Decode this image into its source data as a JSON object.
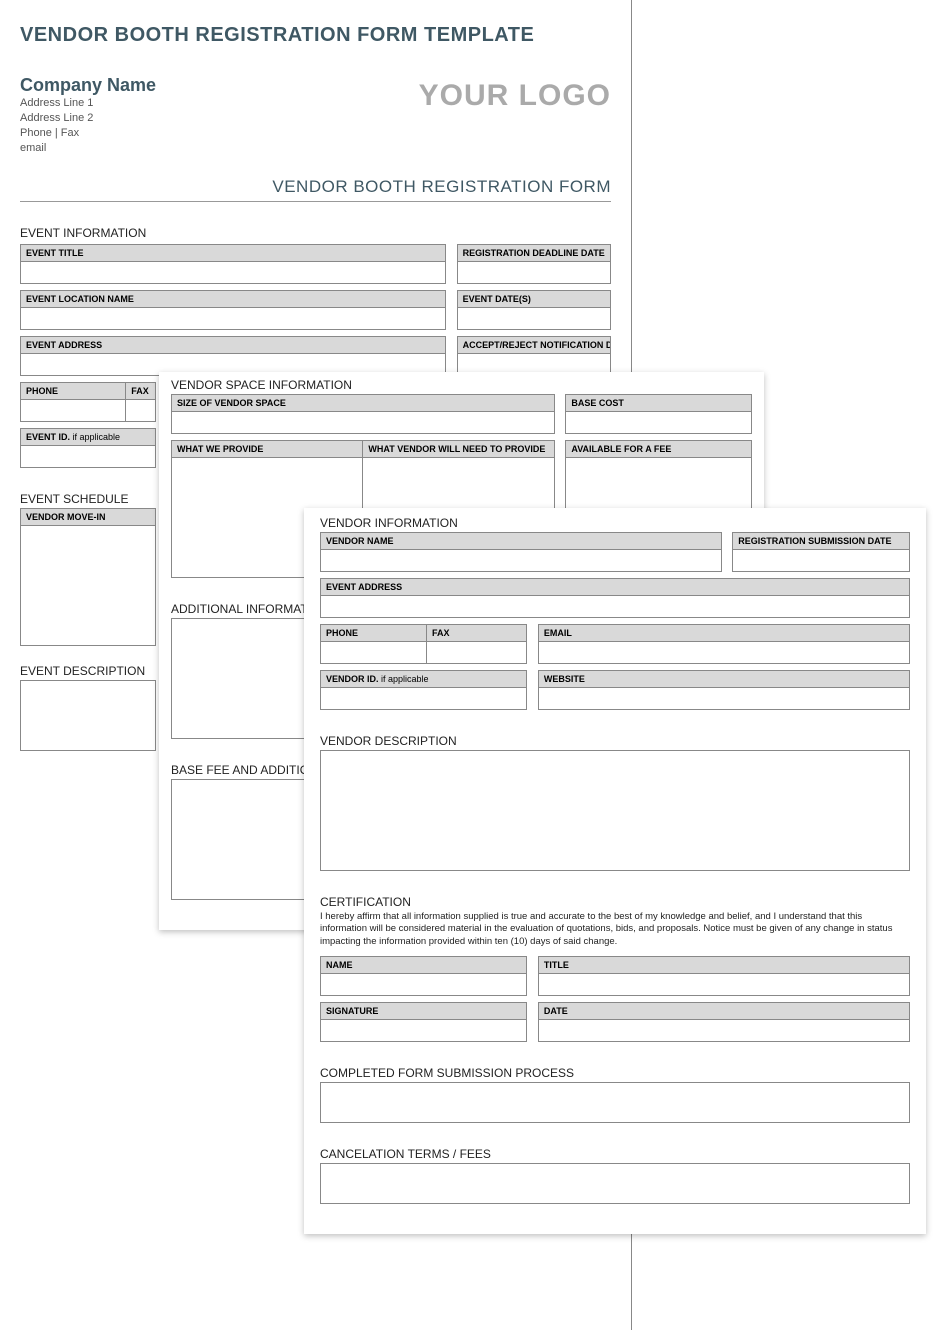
{
  "doc_title": "VENDOR BOOTH REGISTRATION FORM TEMPLATE",
  "company": {
    "name": "Company Name",
    "addr1": "Address Line 1",
    "addr2": "Address Line 2",
    "phone_fax": "Phone | Fax",
    "email": "email"
  },
  "logo_text": "YOUR LOGO",
  "form_title": "VENDOR BOOTH REGISTRATION FORM",
  "sections": {
    "event_information": "EVENT INFORMATION",
    "event_schedule": "EVENT SCHEDULE",
    "event_description": "EVENT DESCRIPTION",
    "vendor_space_information": "VENDOR SPACE INFORMATION",
    "additional_information": "ADDITIONAL INFORMATION",
    "base_fee": "BASE FEE AND ADDITIONAL COSTS",
    "vendor_information": "VENDOR INFORMATION",
    "vendor_description": "VENDOR DESCRIPTION",
    "certification": "CERTIFICATION",
    "submission_process": "COMPLETED FORM SUBMISSION PROCESS",
    "cancelation": "CANCELATION TERMS / FEES"
  },
  "labels": {
    "event_title": "EVENT TITLE",
    "reg_deadline": "REGISTRATION DEADLINE DATE",
    "event_location": "EVENT LOCATION NAME",
    "event_dates": "EVENT DATE(S)",
    "event_address": "EVENT ADDRESS",
    "accept_reject": "ACCEPT/REJECT NOTIFICATION DATE",
    "phone": "PHONE",
    "fax": "FAX",
    "event_id": "EVENT ID.",
    "if_applicable": " if applicable",
    "vendor_move_in": "VENDOR MOVE-IN",
    "size_vendor_space": "SIZE OF VENDOR SPACE",
    "base_cost": "BASE COST",
    "what_we_provide": "WHAT WE PROVIDE",
    "vendor_need_provide": "WHAT VENDOR WILL NEED TO PROVIDE",
    "available_fee": "AVAILABLE FOR A FEE",
    "vendor_name": "VENDOR NAME",
    "reg_submission": "REGISTRATION SUBMISSION DATE",
    "email": "EMAIL",
    "vendor_id": "VENDOR ID.",
    "website": "WEBSITE",
    "name": "NAME",
    "title": "TITLE",
    "signature": "SIGNATURE",
    "date": "DATE"
  },
  "certification_text": "I hereby affirm that all information supplied is true and accurate to the best of my knowledge and belief, and I understand that this information will be considered material in the evaluation of quotations, bids, and proposals. Notice must be given of any change in status impacting the information provided within ten (10) days of said change."
}
